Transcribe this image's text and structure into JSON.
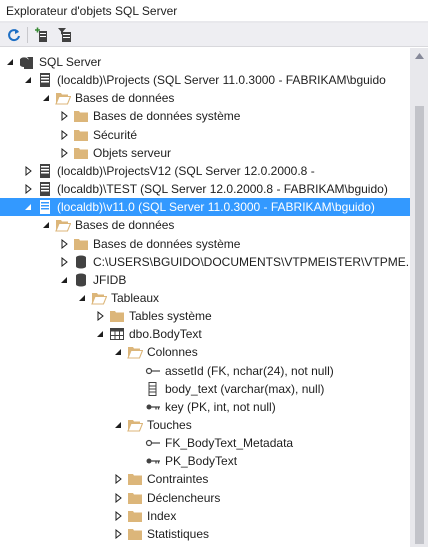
{
  "window": {
    "title": "Explorateur d'objets SQL Server"
  },
  "toolbar": {
    "refresh": "refresh-icon",
    "add_server": "add-server-icon",
    "filter": "filter-icon"
  },
  "colors": {
    "selection": "#3399ff",
    "folder": "#dcb67a",
    "text": "#1e1e1e"
  },
  "tree": [
    {
      "label": "SQL Server",
      "icon": "sql-server-icon",
      "state": "expanded"
    },
    {
      "label": "(localdb)\\Projects (SQL Server 11.0.3000 - FABRIKAM\\bguido",
      "icon": "server-instance-icon",
      "state": "expanded"
    },
    {
      "label": "Bases de données",
      "icon": "folder-open-icon",
      "state": "expanded"
    },
    {
      "label": "Bases de données système",
      "icon": "folder-icon",
      "state": "collapsed"
    },
    {
      "label": "Sécurité",
      "icon": "folder-icon",
      "state": "collapsed"
    },
    {
      "label": "Objets serveur",
      "icon": "folder-icon",
      "state": "collapsed"
    },
    {
      "label": "(localdb)\\ProjectsV12 (SQL Server 12.0.2000.8 -",
      "icon": "server-instance-icon",
      "state": "collapsed"
    },
    {
      "label": "(localdb)\\TEST (SQL Server 12.0.2000.8 - FABRIKAM\\bguido)",
      "icon": "server-instance-icon",
      "state": "collapsed"
    },
    {
      "label": "(localdb)\\v11.0 (SQL Server 11.0.3000 - FABRIKAM\\bguido)",
      "icon": "server-instance-icon",
      "state": "expanded",
      "selected": true
    },
    {
      "label": "Bases de données",
      "icon": "folder-open-icon",
      "state": "expanded"
    },
    {
      "label": "Bases de données système",
      "icon": "folder-icon",
      "state": "collapsed"
    },
    {
      "label": "C:\\USERS\\BGUIDO\\DOCUMENTS\\VTPMEISTER\\VTPME...",
      "icon": "database-icon",
      "state": "collapsed"
    },
    {
      "label": "JFIDB",
      "icon": "database-icon",
      "state": "expanded"
    },
    {
      "label": "Tableaux",
      "icon": "folder-open-icon",
      "state": "expanded"
    },
    {
      "label": "Tables système",
      "icon": "folder-icon",
      "state": "collapsed"
    },
    {
      "label": "dbo.BodyText",
      "icon": "table-icon",
      "state": "expanded"
    },
    {
      "label": "Colonnes",
      "icon": "folder-open-icon",
      "state": "expanded"
    },
    {
      "label": "assetId (FK, nchar(24), not null)",
      "icon": "foreign-key-column-icon",
      "state": "leaf"
    },
    {
      "label": "body_text (varchar(max), null)",
      "icon": "column-icon",
      "state": "leaf"
    },
    {
      "label": "key (PK, int, not null)",
      "icon": "primary-key-column-icon",
      "state": "leaf"
    },
    {
      "label": "Touches",
      "icon": "folder-open-icon",
      "state": "expanded"
    },
    {
      "label": "FK_BodyText_Metadata",
      "icon": "foreign-key-icon",
      "state": "leaf"
    },
    {
      "label": "PK_BodyText",
      "icon": "primary-key-icon",
      "state": "leaf"
    },
    {
      "label": "Contraintes",
      "icon": "folder-icon",
      "state": "collapsed"
    },
    {
      "label": "Déclencheurs",
      "icon": "folder-icon",
      "state": "collapsed"
    },
    {
      "label": "Index",
      "icon": "folder-icon",
      "state": "collapsed"
    },
    {
      "label": "Statistiques",
      "icon": "folder-icon",
      "state": "collapsed"
    }
  ]
}
